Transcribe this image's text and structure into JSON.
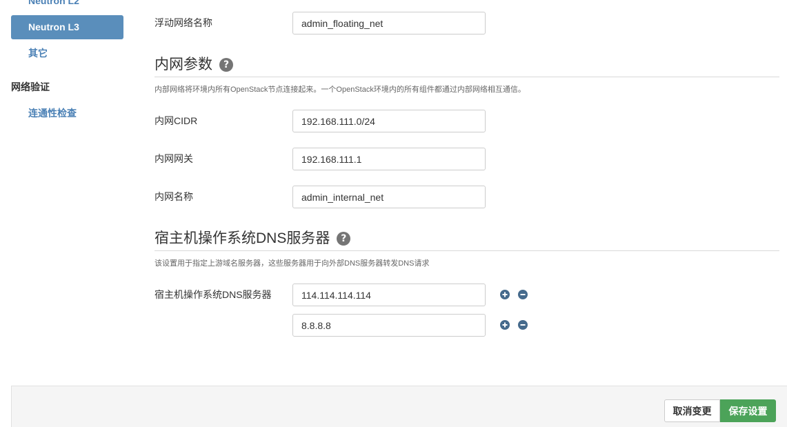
{
  "sidebar": {
    "groups": [
      {
        "items": [
          {
            "label": "Neutron L2"
          },
          {
            "label": "Neutron L3",
            "active": true
          },
          {
            "label": "其它"
          }
        ]
      },
      {
        "header": "网络验证",
        "items": [
          {
            "label": "连通性检查"
          }
        ]
      }
    ]
  },
  "main": {
    "floating_network": {
      "label": "浮动网络名称",
      "value": "admin_floating_net"
    },
    "internal_network": {
      "title": "内网参数",
      "description": "内部网络将环境内所有OpenStack节点连接起来。一个OpenStack环境内的所有组件都通过内部网络相互通信。",
      "fields": [
        {
          "label": "内网CIDR",
          "value": "192.168.111.0/24"
        },
        {
          "label": "内网网关",
          "value": "192.168.111.1"
        },
        {
          "label": "内网名称",
          "value": "admin_internal_net"
        }
      ]
    },
    "dns": {
      "title": "宿主机操作系统DNS服务器",
      "description": "该设置用于指定上游域名服务器，这些服务器用于向外部DNS服务器转发DNS请求",
      "field_label": "宿主机操作系统DNS服务器",
      "servers": [
        "114.114.114.114",
        "8.8.8.8"
      ]
    }
  },
  "footer": {
    "cancel_label": "取消变更",
    "save_label": "保存设置"
  },
  "icons": {
    "help": "question-circle-icon",
    "add": "plus-circle-icon",
    "remove": "minus-circle-icon"
  },
  "colors": {
    "accent": "#5a8ebb",
    "link": "#4a80b5",
    "save_button": "#4ca359",
    "action_icon": "#456a8c",
    "help_icon": "#757575"
  }
}
